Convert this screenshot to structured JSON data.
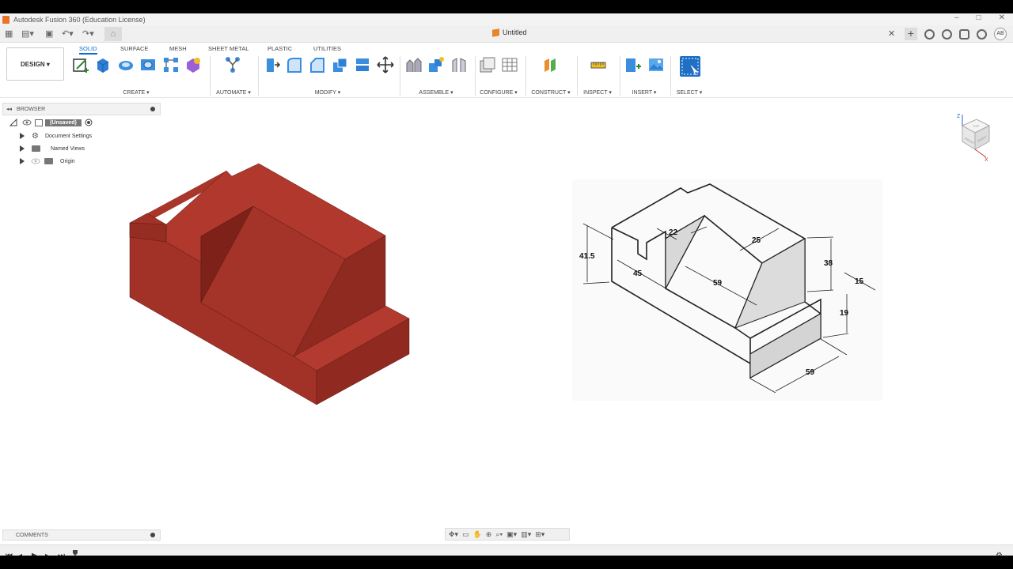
{
  "window": {
    "title": "Autodesk Fusion 360 (Education License)",
    "controls": [
      "–",
      "□",
      "✕"
    ]
  },
  "document": {
    "tab_name": "Untitled",
    "user_initials": "AB"
  },
  "ribbon": {
    "workspace": "DESIGN ▾",
    "tabs": [
      "SOLID",
      "SURFACE",
      "MESH",
      "SHEET METAL",
      "PLASTIC",
      "UTILITIES"
    ],
    "active_tab": "SOLID",
    "groups": [
      "CREATE ▾",
      "AUTOMATE ▾",
      "MODIFY ▾",
      "ASSEMBLE ▾",
      "CONFIGURE ▾",
      "CONSTRUCT ▾",
      "INSPECT ▾",
      "INSERT ▾",
      "SELECT ▾"
    ]
  },
  "browser": {
    "header": "BROWSER",
    "root": "(Unsaved)",
    "items": [
      "Document Settings",
      "Named Views",
      "Origin"
    ]
  },
  "comments": {
    "header": "COMMENTS"
  },
  "drawing": {
    "dimensions": [
      "41.5",
      "22",
      "25",
      "45",
      "59",
      "38",
      "15",
      "19",
      "59"
    ]
  },
  "viewcube": {
    "faces": [
      "TOP",
      "FRONT",
      "RIGHT"
    ],
    "axes": [
      "Z",
      "X"
    ]
  },
  "colors": {
    "model": "#a6342a",
    "model_dark": "#7e231c",
    "model_light": "#b83a2f",
    "accent": "#0a6fd0"
  }
}
